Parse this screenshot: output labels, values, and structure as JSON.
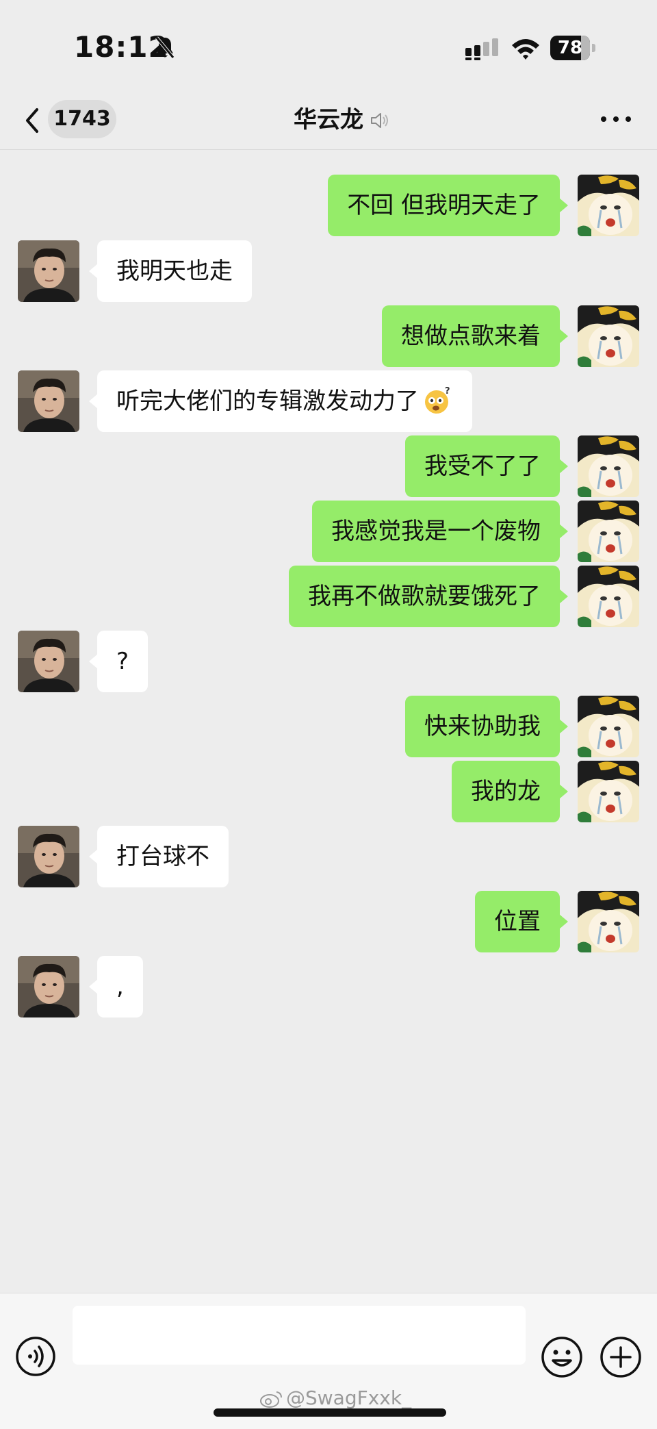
{
  "status_bar": {
    "time": "18:12",
    "battery_level": "78",
    "battery_fraction": 0.78,
    "icons": [
      "bell-muted-icon",
      "cellular-signal-icon",
      "wifi-icon",
      "battery-icon"
    ]
  },
  "header": {
    "back_icon": "chevron-left-icon",
    "unread_count": "1743",
    "title": "华云龙",
    "title_icon": "mute-icon",
    "more_icon": "ellipsis-icon"
  },
  "messages": [
    {
      "sender": "self",
      "text": "不回 但我明天走了"
    },
    {
      "sender": "other",
      "text": "我明天也走"
    },
    {
      "sender": "self",
      "text": "想做点歌来着"
    },
    {
      "sender": "other",
      "text": "听完大佬们的专辑激发动力了",
      "emoji": "confused-face-emoji"
    },
    {
      "sender": "self",
      "text": "我受不了了"
    },
    {
      "sender": "self",
      "text": "我感觉我是一个废物"
    },
    {
      "sender": "self",
      "text": "我再不做歌就要饿死了"
    },
    {
      "sender": "other",
      "text": "?"
    },
    {
      "sender": "self",
      "text": "快来协助我"
    },
    {
      "sender": "self",
      "text": "我的龙"
    },
    {
      "sender": "other",
      "text": "打台球不"
    },
    {
      "sender": "self",
      "text": "位置"
    },
    {
      "sender": "other",
      "text": ","
    }
  ],
  "input_bar": {
    "voice_icon": "voice-icon",
    "input_value": "",
    "emoji_icon": "smiley-icon",
    "plus_icon": "plus-icon"
  },
  "watermark": {
    "text": "@SwagFxxk_"
  },
  "colors": {
    "background": "#ededed",
    "outgoing_bubble": "#95ec69",
    "incoming_bubble": "#ffffff",
    "input_bar": "#f6f6f6"
  }
}
